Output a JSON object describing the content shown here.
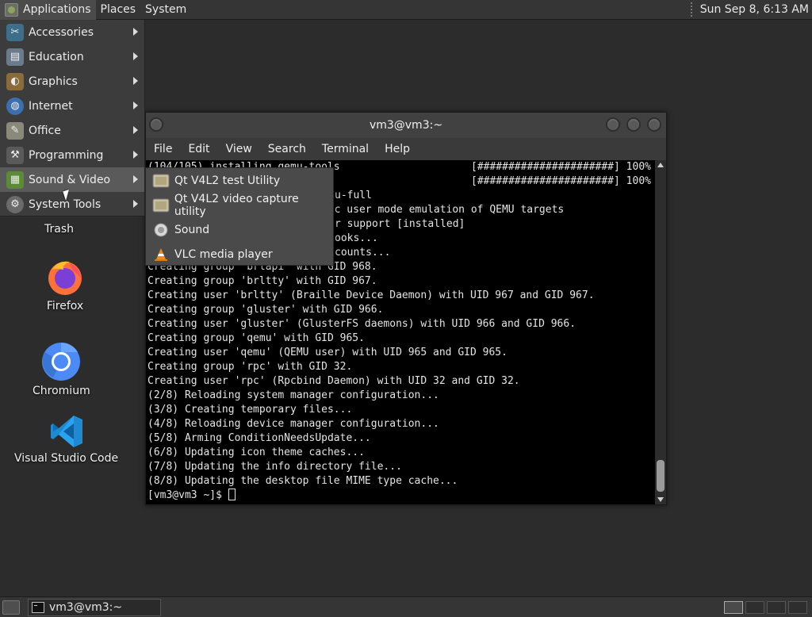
{
  "top_panel": {
    "menus": [
      "Applications",
      "Places",
      "System"
    ],
    "clock": "Sun Sep  8,  6:13 AM"
  },
  "apps_menu": {
    "items": [
      {
        "label": "Accessories",
        "icon": "accessories-icon"
      },
      {
        "label": "Education",
        "icon": "education-icon"
      },
      {
        "label": "Graphics",
        "icon": "graphics-icon"
      },
      {
        "label": "Internet",
        "icon": "internet-globe-icon"
      },
      {
        "label": "Office",
        "icon": "office-icon"
      },
      {
        "label": "Programming",
        "icon": "programming-icon"
      },
      {
        "label": "Sound & Video",
        "icon": "sound-video-icon"
      },
      {
        "label": "System Tools",
        "icon": "system-tools-gear-icon"
      }
    ],
    "active_item": "Sound & Video"
  },
  "submenu": {
    "items": [
      {
        "label": "Qt V4L2 test Utility",
        "icon": "qt-v4l2-icon"
      },
      {
        "label": "Qt V4L2 video capture utility",
        "icon": "qt-v4l2-capture-icon"
      },
      {
        "label": "Sound",
        "icon": "sound-icon"
      },
      {
        "label": "VLC media player",
        "icon": "vlc-cone-icon"
      }
    ]
  },
  "desktop_icons": [
    {
      "label": "Trash",
      "icon": "trash-icon"
    },
    {
      "label": "Firefox",
      "icon": "firefox-icon"
    },
    {
      "label": "Chromium",
      "icon": "chromium-icon"
    },
    {
      "label": "Visual Studio Code",
      "icon": "vscode-icon"
    }
  ],
  "terminal": {
    "title": "vm3@vm3:~",
    "menus": [
      "File",
      "Edit",
      "View",
      "Search",
      "Terminal",
      "Help"
    ],
    "lines": [
      "(104/105) installing qemu-tools",
      "Creating group 'brlapi' with GID 968.",
      "Creating group 'brltty' with GID 967.",
      "Creating user 'brltty' (Braille Device Daemon) with UID 967 and GID 967.",
      "Creating group 'gluster' with GID 966.",
      "Creating user 'gluster' (GlusterFS daemons) with UID 966 and GID 966.",
      "Creating group 'qemu' with GID 965.",
      "Creating user 'qemu' (QEMU user) with UID 965 and GID 965.",
      "Creating group 'rpc' with GID 32.",
      "Creating user 'rpc' (Rpcbind Daemon) with UID 32 and GID 32.",
      "(2/8) Reloading system manager configuration...",
      "(3/8) Creating temporary files...",
      "(4/8) Reloading device manager configuration...",
      "(5/8) Arming ConditionNeedsUpdate...",
      "(6/8) Updating icon theme caches...",
      "(7/8) Updating the info directory file...",
      "(8/8) Updating the desktop file MIME type cache..."
    ],
    "partial_lines": [
      "u-full",
      "tic user mode emulation of QEMU targets",
      "r support [installed]",
      "ooks...",
      "counts..."
    ],
    "progress_1": "[######################] 100%",
    "progress_2": "[######################] 100%",
    "prompt": "[vm3@vm3 ~]$ "
  },
  "bottom_panel": {
    "task_label": "vm3@vm3:~",
    "workspaces": 4
  }
}
